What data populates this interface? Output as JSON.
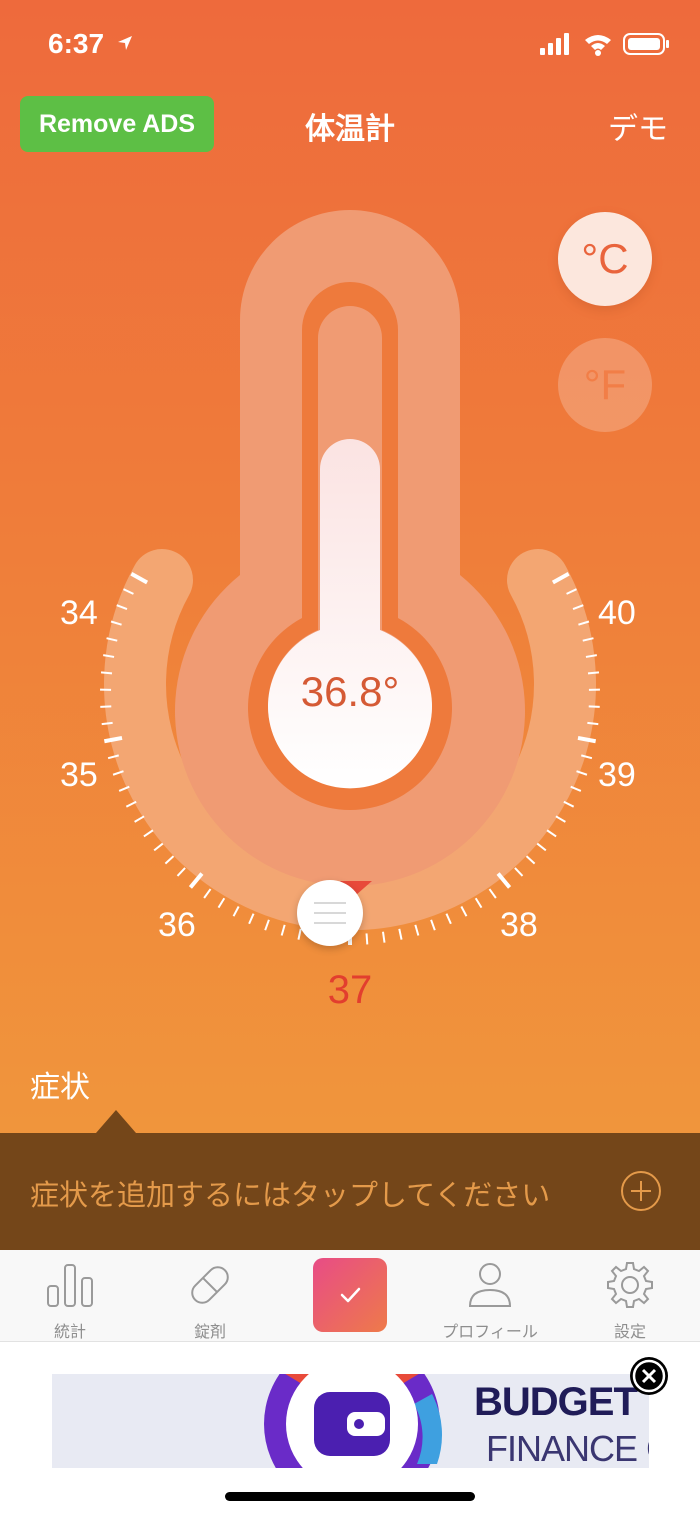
{
  "status": {
    "time": "6:37"
  },
  "nav": {
    "remove_ads": "Remove ADS",
    "title": "体温計",
    "demo": "デモ"
  },
  "units": {
    "celsius": "°C",
    "fahrenheit": "°F",
    "selected": "celsius"
  },
  "thermometer": {
    "value": "36.8°",
    "fill_fraction": 0.8
  },
  "scale": {
    "labels": [
      "34",
      "35",
      "36",
      "38",
      "39",
      "40"
    ],
    "selected": "37"
  },
  "symptoms": {
    "label": "症状",
    "prompt": "症状を追加するにはタップしてください"
  },
  "tabbar": {
    "tabs": [
      {
        "label": "統計",
        "icon": "bar-chart-icon"
      },
      {
        "label": "錠剤",
        "icon": "pill-icon"
      },
      {
        "label": "",
        "icon": "check-icon"
      },
      {
        "label": "プロフィール",
        "icon": "person-icon"
      },
      {
        "label": "設定",
        "icon": "gear-icon"
      }
    ]
  },
  "ad": {
    "line1": "BUDGET PLA",
    "line2": "FINANCE CO"
  },
  "colors": {
    "background_top": "#EE6A3C",
    "background_bottom": "#F09A3C",
    "remove_ads": "#5DBF45",
    "symptom_bar": "#744619",
    "selected_value": "#E23E2E"
  }
}
